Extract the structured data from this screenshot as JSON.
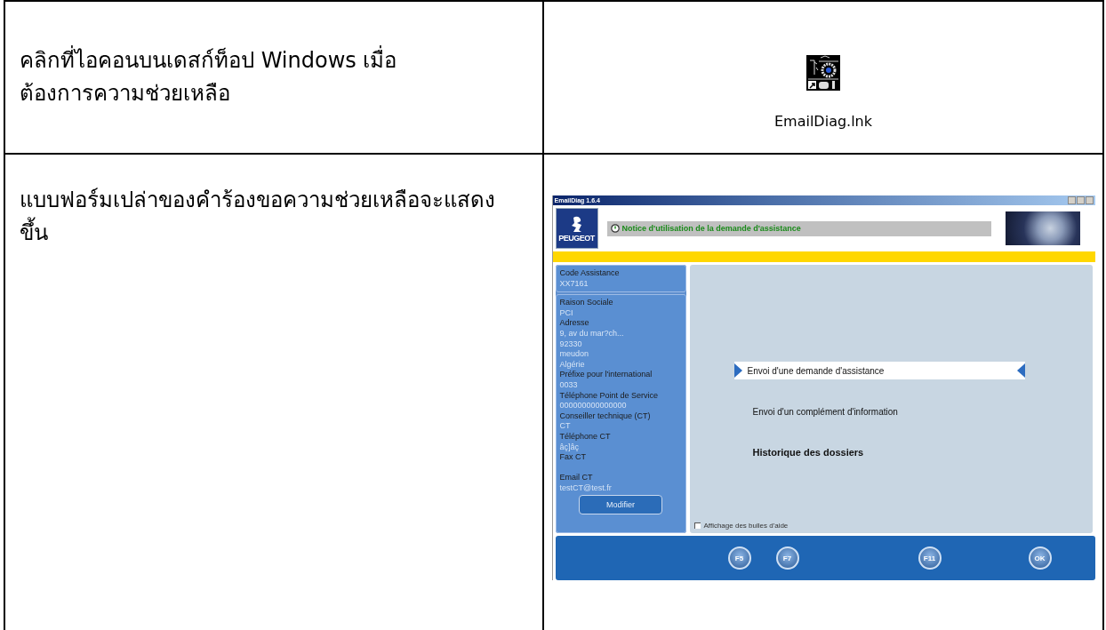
{
  "rows": [
    {
      "instruction": "คลิกที่ไอคอนบนเดสก์ท็อป Windows เมื่อต้องการความช่วยเหลือ",
      "illustration": {
        "kind": "desktop_icon",
        "label": "EmailDiag.lnk"
      }
    },
    {
      "instruction": "แบบฟอร์มเปล่าของคำร้องขอความช่วยเหลือจะแสดงขึ้น",
      "illustration": {
        "kind": "app_window",
        "window": {
          "title": "EmailDiag 1.6.4",
          "logo_text": "PEUGEOT",
          "notice": "Notice d'utilisation de la demande d'assistance",
          "sidebar": {
            "groups": [
              {
                "fields": [
                  {
                    "label": "Code Assistance",
                    "values": [
                      "XX7161"
                    ]
                  }
                ]
              },
              {
                "fields": [
                  {
                    "label": "Raison Sociale",
                    "values": [
                      "PCI"
                    ]
                  },
                  {
                    "label": "Adresse",
                    "values": [
                      "9, av du mar?ch...",
                      "92330",
                      "meudon",
                      "Algérie"
                    ]
                  },
                  {
                    "label": "Préfixe pour l'international",
                    "values": [
                      "0033"
                    ]
                  },
                  {
                    "label": "Téléphone Point de Service",
                    "values": [
                      "000000000000000"
                    ]
                  },
                  {
                    "label": "Conseiller technique (CT)",
                    "values": [
                      "CT"
                    ]
                  },
                  {
                    "label": "Téléphone CT",
                    "values": [
                      "âç]âç"
                    ]
                  },
                  {
                    "label": "Fax CT"
                  },
                  {
                    "label": "Email CT",
                    "values": [
                      "testCT@test.fr"
                    ]
                  }
                ]
              }
            ],
            "button": "Modifier"
          },
          "menu": [
            {
              "label": "Envoi d'une demande d'assistance",
              "selected": true
            },
            {
              "label": "Envoi d'un complément d'information",
              "selected": false
            },
            {
              "label": "Historique des dossiers",
              "selected": false
            }
          ],
          "help_bubbles": {
            "label": "Affichage des bulles d'aide",
            "checked": false
          },
          "toolbar": [
            {
              "key": "F5"
            },
            {
              "key": "F7"
            },
            {
              "key": "F11"
            },
            {
              "key": "OK"
            }
          ]
        }
      }
    }
  ]
}
